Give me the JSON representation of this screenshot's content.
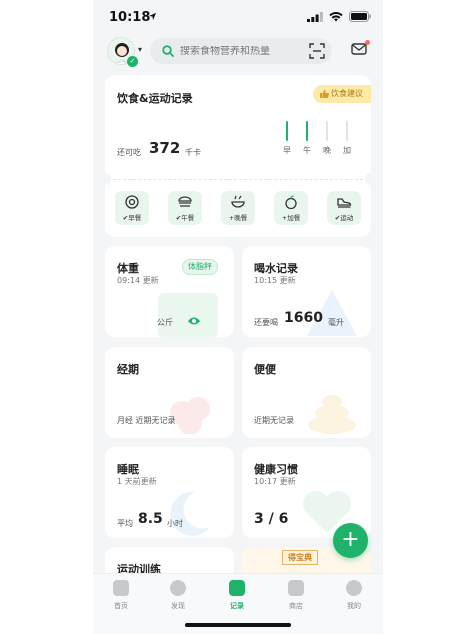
{
  "status_bar": {
    "time": "10:18"
  },
  "header": {
    "search_placeholder": "搜索食物营养和热量"
  },
  "diet_card": {
    "title": "饮食&运动记录",
    "tip_button": "饮食建议",
    "remaining_label": "还可吃",
    "remaining_value": "372",
    "remaining_unit": "千卡",
    "meals_progress": [
      {
        "label": "早",
        "done": true
      },
      {
        "label": "午",
        "done": true
      },
      {
        "label": "晚",
        "done": false
      },
      {
        "label": "加",
        "done": false
      }
    ],
    "actions": [
      {
        "label": "早餐",
        "icon": "egg-icon",
        "state": "check"
      },
      {
        "label": "午餐",
        "icon": "burger-icon",
        "state": "check"
      },
      {
        "label": "晚餐",
        "icon": "bowl-icon",
        "state": "add"
      },
      {
        "label": "加餐",
        "icon": "apple-icon",
        "state": "add"
      },
      {
        "label": "运动",
        "icon": "shoe-icon",
        "state": "check"
      }
    ]
  },
  "tiles": {
    "weight": {
      "title": "体重",
      "sub": "09:14 更新",
      "badge": "体脂秤",
      "unit": "公斤"
    },
    "water": {
      "title": "喝水记录",
      "sub": "10:15 更新",
      "prefix": "还要喝",
      "value": "1660",
      "unit": "毫升"
    },
    "period": {
      "title": "经期",
      "note": "月经 近期无记录"
    },
    "poop": {
      "title": "便便",
      "note": "近期无记录"
    },
    "sleep": {
      "title": "睡眠",
      "sub": "1 天前更新",
      "prefix": "平均",
      "value": "8.5",
      "unit": "小时"
    },
    "habits": {
      "title": "健康习惯",
      "sub": "10:17 更新",
      "value": "3 / 6"
    },
    "training": {
      "title": "运动训练"
    },
    "treasure_badge": "得宝典"
  },
  "tabbar": [
    {
      "label": "首页",
      "active": false
    },
    {
      "label": "发现",
      "active": false
    },
    {
      "label": "记录",
      "active": true
    },
    {
      "label": "商店",
      "active": false
    },
    {
      "label": "我的",
      "active": false
    }
  ],
  "colors": {
    "accent": "#1fb26b",
    "background": "#f3f5f7",
    "tip": "#fde9a8"
  }
}
